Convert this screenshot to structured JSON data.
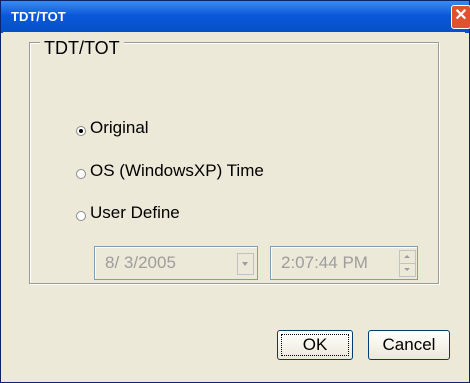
{
  "window": {
    "title": "TDT/TOT",
    "close_glyph": "✕"
  },
  "group": {
    "label": "TDT/TOT"
  },
  "options": [
    {
      "label": "Original",
      "selected": true
    },
    {
      "label": "OS (WindowsXP) Time",
      "selected": false
    },
    {
      "label": "User Define",
      "selected": false
    }
  ],
  "date_picker": {
    "value": "8/  3/2005",
    "enabled": false,
    "icon": "chevron-down-icon"
  },
  "time_picker": {
    "value": "2:07:44 PM",
    "enabled": false,
    "icon": "spin-icon"
  },
  "buttons": {
    "ok": "OK",
    "cancel": "Cancel"
  }
}
